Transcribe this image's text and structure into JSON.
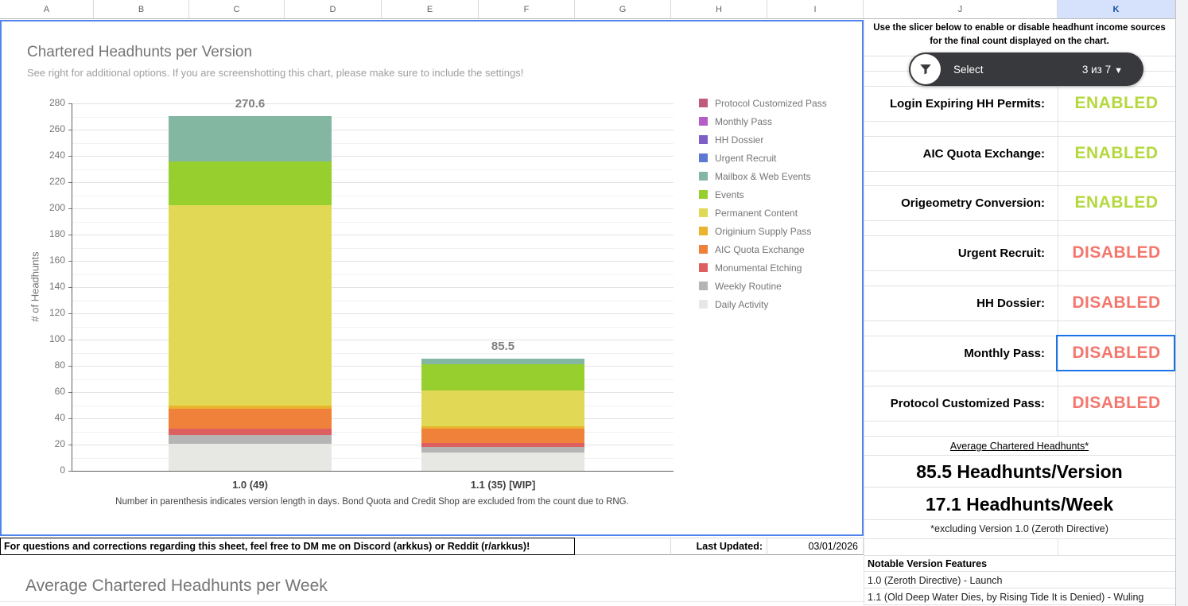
{
  "sheet": {
    "column_headers": [
      "A",
      "B",
      "C",
      "D",
      "E",
      "F",
      "G",
      "H",
      "I",
      "J",
      "K"
    ],
    "selected_column": "K"
  },
  "chart1": {
    "title": "Chartered Headhunts per Version",
    "subtitle": "See right for additional options. If you are screenshotting this chart, please make sure to include the settings!",
    "y_axis_title": "# of Headhunts",
    "note": "Number in parenthesis indicates version length in days. Bond Quota and Credit Shop are excluded from the count due to RNG."
  },
  "chart_data": {
    "type": "bar",
    "stacked": true,
    "title": "Chartered Headhunts per Version",
    "xlabel": "",
    "ylabel": "# of Headhunts",
    "ylim": [
      0,
      280
    ],
    "ytick_step": 20,
    "grid": true,
    "legend_position": "right",
    "categories": [
      "1.0 (49)",
      "1.1 (35) [WIP]"
    ],
    "totals": [
      270.6,
      85.5
    ],
    "series": [
      {
        "name": "Daily Activity",
        "color": "#e7e7e3",
        "values": [
          20.5,
          14
        ]
      },
      {
        "name": "Weekly Routine",
        "color": "#b5b5b5",
        "values": [
          6.5,
          4
        ]
      },
      {
        "name": "Monumental Etching",
        "color": "#de5f5f",
        "values": [
          5,
          3
        ]
      },
      {
        "name": "AIC Quota Exchange",
        "color": "#f0813a",
        "values": [
          15,
          11
        ]
      },
      {
        "name": "Originium Supply Pass",
        "color": "#e9b32c",
        "values": [
          2.5,
          2
        ]
      },
      {
        "name": "Permanent Content",
        "color": "#e1d955",
        "values": [
          153,
          27
        ]
      },
      {
        "name": "Events",
        "color": "#97cf2e",
        "values": [
          33.5,
          20
        ]
      },
      {
        "name": "Mailbox & Web Events",
        "color": "#83b7a2",
        "values": [
          34.6,
          4.5
        ]
      },
      {
        "name": "Urgent Recruit",
        "color": "#5c78d1",
        "values": [
          0,
          0
        ]
      },
      {
        "name": "HH Dossier",
        "color": "#7d5fc7",
        "values": [
          0,
          0
        ]
      },
      {
        "name": "Monthly Pass",
        "color": "#b45cc8",
        "values": [
          0,
          0
        ]
      },
      {
        "name": "Protocol Customized Pass",
        "color": "#c15b7c",
        "values": [
          0,
          0
        ]
      }
    ],
    "legend_order": [
      "Protocol Customized Pass",
      "Monthly Pass",
      "HH Dossier",
      "Urgent Recruit",
      "Mailbox & Web Events",
      "Events",
      "Permanent Content",
      "Originium Supply Pass",
      "AIC Quota Exchange",
      "Monumental Etching",
      "Weekly Routine",
      "Daily Activity"
    ]
  },
  "right_panel": {
    "instruction": "Use the slicer below to enable or disable headhunt income sources for the final count displayed on the chart.",
    "slicer": {
      "label": "Select",
      "count": "3 из 7",
      "filter_icon": "funnel-icon"
    },
    "toggles": [
      {
        "label": "Login Expiring HH Permits:",
        "value": "ENABLED",
        "selected": false
      },
      {
        "label": "AIC Quota Exchange:",
        "value": "ENABLED",
        "selected": false
      },
      {
        "label": "Origeometry Conversion:",
        "value": "ENABLED",
        "selected": false
      },
      {
        "label": "Urgent Recruit:",
        "value": "DISABLED",
        "selected": false
      },
      {
        "label": "HH Dossier:",
        "value": "DISABLED",
        "selected": false
      },
      {
        "label": "Monthly Pass:",
        "value": "DISABLED",
        "selected": true
      },
      {
        "label": "Protocol Customized Pass:",
        "value": "DISABLED",
        "selected": false
      }
    ],
    "colors": {
      "enabled": "#b4d83e",
      "disabled": "#f4766c",
      "selection": "#1a73e8"
    },
    "summary": {
      "title": "Average Chartered Headhunts*",
      "per_version": "85.5 Headhunts/Version",
      "per_week": "17.1 Headhunts/Week",
      "footnote": "*excluding Version 1.0 (Zeroth Directive)"
    },
    "notable": {
      "header": "Notable Version Features",
      "rows": [
        "1.0 (Zeroth Directive) - Launch",
        "1.1 (Old Deep Water Dies, by Rising Tide It is Denied) - Wuling"
      ]
    }
  },
  "footer": {
    "message": "For questions and corrections regarding this sheet, feel free to DM me on Discord (arkkus) or Reddit (r/arkkus)!",
    "last_updated_label": "Last Updated:",
    "last_updated_value": "03/01/2026"
  },
  "chart2": {
    "title": "Average Chartered Headhunts per Week"
  }
}
